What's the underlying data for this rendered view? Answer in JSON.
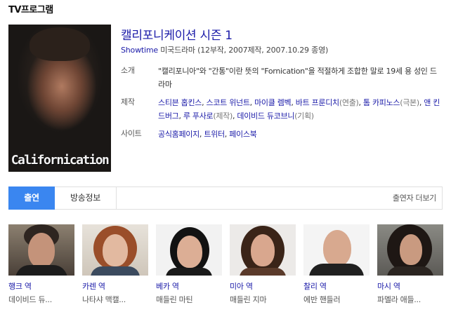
{
  "section_title": "TV프로그램",
  "poster": {
    "logo_text": "Californication"
  },
  "show": {
    "title": "캘리포니케이션 시즌 1",
    "network": "Showtime",
    "meta": " 미국드라마 (12부작, 2007제작, 2007.10.29 종영)"
  },
  "info": {
    "intro_label": "소개",
    "intro_text": "\"캘리포니아\"와 \"간통\"이란 뜻의 \"Fornication\"을 적절하게 조합한 말로 19세 용 성인 드라마",
    "production_label": "제작",
    "production": [
      {
        "name": "스티븐 홉킨스",
        "role": "",
        "sep": ", "
      },
      {
        "name": "스코트 위넌트",
        "role": "",
        "sep": ", "
      },
      {
        "name": "마이클 렘벡",
        "role": "",
        "sep": ", "
      },
      {
        "name": "바트 프룬디치",
        "role": "(연출)",
        "sep": ", "
      },
      {
        "name": "톰 카피노스",
        "role": "(극본)",
        "sep": ", "
      },
      {
        "name": "앤 킨드버그",
        "role": "",
        "sep": ", "
      },
      {
        "name": "루 푸사로",
        "role": "(제작)",
        "sep": ", "
      },
      {
        "name": "데이비드 듀코브니",
        "role": "(기획)",
        "sep": ""
      }
    ],
    "site_label": "사이트",
    "sites": [
      {
        "name": "공식홈페이지",
        "sep": ", "
      },
      {
        "name": "트위터",
        "sep": ", "
      },
      {
        "name": "페이스북",
        "sep": ""
      }
    ]
  },
  "tabs": {
    "cast": "출연",
    "broadcast": "방송정보",
    "more": "출연자 더보기"
  },
  "cast": [
    {
      "role": "행크 역",
      "name": "데이비드 듀..."
    },
    {
      "role": "카렌 역",
      "name": "나타샤 맥캘..."
    },
    {
      "role": "베카 역",
      "name": "매들린 마틴"
    },
    {
      "role": "미아 역",
      "name": "매들린 지마"
    },
    {
      "role": "찰리 역",
      "name": "에반 핸들러"
    },
    {
      "role": "마시 역",
      "name": "파멜라 애들..."
    }
  ],
  "colors": {
    "accent": "#3a86f0",
    "link": "#1a1aa8"
  }
}
